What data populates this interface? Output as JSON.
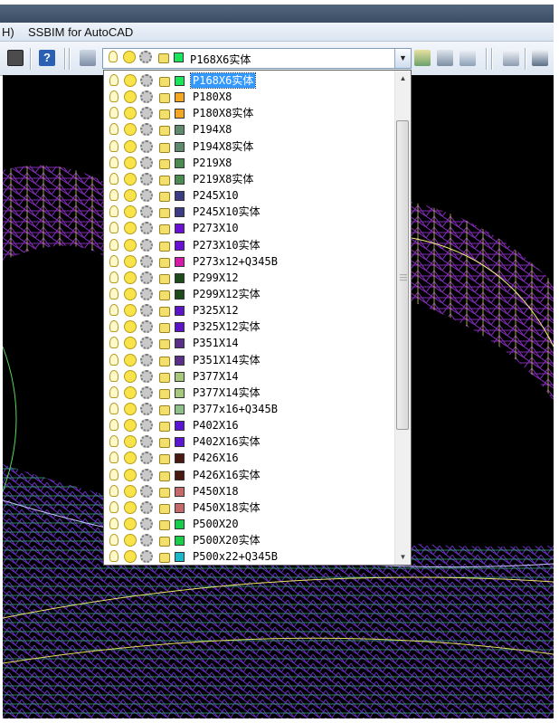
{
  "menubar": {
    "menu_fragment": "H)",
    "app_title": "SSBIM for AutoCAD"
  },
  "layer_combo": {
    "current": "P168X6实体",
    "current_color": "#19e65a"
  },
  "layers": [
    {
      "name": "P168X6实体",
      "color": "#19e65a",
      "selected": true
    },
    {
      "name": "P180X8",
      "color": "#f5a623"
    },
    {
      "name": "P180X8实体",
      "color": "#f5a623"
    },
    {
      "name": "P194X8",
      "color": "#5f8a6e"
    },
    {
      "name": "P194X8实体",
      "color": "#5f8a6e"
    },
    {
      "name": "P219X8",
      "color": "#4d8a52"
    },
    {
      "name": "P219X8实体",
      "color": "#4d8a52"
    },
    {
      "name": "P245X10",
      "color": "#3c3c84"
    },
    {
      "name": "P245X10实体",
      "color": "#3c3c84"
    },
    {
      "name": "P273X10",
      "color": "#6a0fd4"
    },
    {
      "name": "P273X10实体",
      "color": "#6a0fd4"
    },
    {
      "name": "P273x12+Q345B",
      "color": "#d41aa8"
    },
    {
      "name": "P299X12",
      "color": "#1f4a1a"
    },
    {
      "name": "P299X12实体",
      "color": "#1f4a1a"
    },
    {
      "name": "P325X12",
      "color": "#5b14c6"
    },
    {
      "name": "P325X12实体",
      "color": "#5b14c6"
    },
    {
      "name": "P351X14",
      "color": "#5a2f88"
    },
    {
      "name": "P351X14实体",
      "color": "#5a2f88"
    },
    {
      "name": "P377X14",
      "color": "#a7c77d"
    },
    {
      "name": "P377X14实体",
      "color": "#a7c77d"
    },
    {
      "name": "P377x16+Q345B",
      "color": "#8fbf8a"
    },
    {
      "name": "P402X16",
      "color": "#5a16d0"
    },
    {
      "name": "P402X16实体",
      "color": "#5a16d0"
    },
    {
      "name": "P426X16",
      "color": "#4a1a12"
    },
    {
      "name": "P426X16实体",
      "color": "#4a1a12"
    },
    {
      "name": "P450X18",
      "color": "#c46a6a"
    },
    {
      "name": "P450X18实体",
      "color": "#c46a6a"
    },
    {
      "name": "P500X20",
      "color": "#19cc4a"
    },
    {
      "name": "P500X20实体",
      "color": "#19cc4a"
    },
    {
      "name": "P500x22+Q345B",
      "color": "#1ab8c8"
    }
  ],
  "icons": {
    "calculator": "calculator-icon",
    "help": "help-icon",
    "layer": "layer-icon",
    "bulb": "lightbulb-icon",
    "freeze": "sun-icon",
    "viewport": "gear-icon",
    "lock": "padlock-icon"
  }
}
